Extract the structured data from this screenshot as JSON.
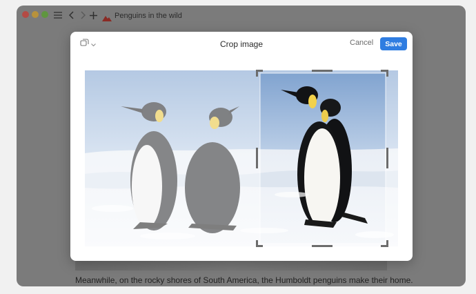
{
  "window": {
    "title": "Penguins in the wild",
    "traffic_lights": [
      "close",
      "minimize",
      "zoom"
    ],
    "toolbar_icons": [
      "sidebar-icon",
      "chevron-left-icon",
      "chevron-right-icon",
      "plus-icon"
    ]
  },
  "dialog": {
    "title": "Crop image",
    "aspect_icon": "aspect-ratio-icon",
    "cancel_label": "Cancel",
    "save_label": "Save"
  },
  "background": {
    "footer_text": "Meanwhile, on the rocky shores of South America, the Humboldt penguins make their home."
  },
  "colors": {
    "accent": "#2f7de1",
    "overlay": "#7b7b7b"
  }
}
